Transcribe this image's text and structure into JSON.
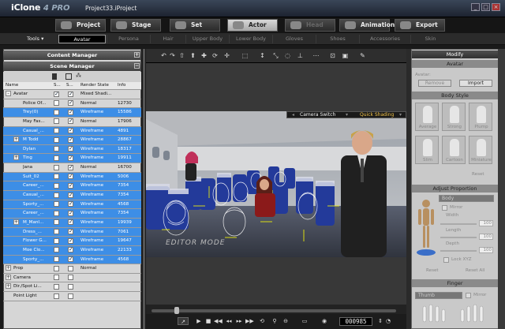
{
  "app": {
    "name": "iClone",
    "version_badge": "4",
    "edition": "PRO",
    "project": "Project33.iProject"
  },
  "window": {
    "minimize": "_",
    "maximize": "□",
    "close": "×"
  },
  "main_tabs": [
    {
      "label": "Project",
      "state": "normal"
    },
    {
      "label": "Stage",
      "state": "normal"
    },
    {
      "label": "Set",
      "state": "normal"
    },
    {
      "label": "Actor",
      "state": "active"
    },
    {
      "label": "Head",
      "state": "disabled"
    },
    {
      "label": "Animation",
      "state": "normal"
    },
    {
      "label": "Export",
      "state": "normal"
    }
  ],
  "tools_label": "Tools ▾",
  "sub_tabs": [
    {
      "label": "Avatar",
      "state": "active"
    },
    {
      "label": "Persona",
      "state": "disabled"
    },
    {
      "label": "Hair",
      "state": "disabled"
    },
    {
      "label": "Upper Body",
      "state": "disabled"
    },
    {
      "label": "Lower Body",
      "state": "disabled"
    },
    {
      "label": "Gloves",
      "state": "disabled"
    },
    {
      "label": "Shoes",
      "state": "disabled"
    },
    {
      "label": "Accessories",
      "state": "disabled"
    },
    {
      "label": "Skin",
      "state": "disabled"
    }
  ],
  "content_manager": {
    "title": "Content Manager"
  },
  "scene_manager": {
    "title": "Scene Manager",
    "columns": {
      "name": "Name",
      "s1": "S...",
      "s2": "S...",
      "render": "Render State",
      "info": "Info"
    },
    "rows": [
      {
        "indent": 0,
        "expander": "-",
        "name": "Avatar",
        "c1": true,
        "c2": true,
        "render": "Mixed Shadi...",
        "info": "",
        "sel": false
      },
      {
        "indent": 1,
        "expander": "",
        "name": "Police Of...",
        "c1": false,
        "c2": true,
        "render": "Normal",
        "info": "12730",
        "sel": false
      },
      {
        "indent": 1,
        "expander": "",
        "name": "Trey(0)",
        "c1": false,
        "c2": true,
        "render": "Wireframe",
        "info": "15586",
        "sel": true
      },
      {
        "indent": 1,
        "expander": "",
        "name": "May Fas...",
        "c1": false,
        "c2": true,
        "render": "Normal",
        "info": "17906",
        "sel": false
      },
      {
        "indent": 1,
        "expander": "",
        "name": "Casual_...",
        "c1": false,
        "c2": true,
        "render": "Wireframe",
        "info": "4891",
        "sel": true
      },
      {
        "indent": 1,
        "expander": "+",
        "name": "M Todd",
        "c1": false,
        "c2": true,
        "render": "Wireframe",
        "info": "28867",
        "sel": true
      },
      {
        "indent": 1,
        "expander": "",
        "name": "Dylan",
        "c1": false,
        "c2": true,
        "render": "Wireframe",
        "info": "18317",
        "sel": true
      },
      {
        "indent": 1,
        "expander": "+",
        "name": "Ting",
        "c1": false,
        "c2": true,
        "render": "Wireframe",
        "info": "19911",
        "sel": true
      },
      {
        "indent": 1,
        "expander": "",
        "name": "Jana",
        "c1": false,
        "c2": true,
        "render": "Normal",
        "info": "16700",
        "sel": false
      },
      {
        "indent": 1,
        "expander": "",
        "name": "Suit_02",
        "c1": false,
        "c2": true,
        "render": "Wireframe",
        "info": "5006",
        "sel": true
      },
      {
        "indent": 1,
        "expander": "",
        "name": "Career_...",
        "c1": false,
        "c2": true,
        "render": "Wireframe",
        "info": "7354",
        "sel": true
      },
      {
        "indent": 1,
        "expander": "",
        "name": "Casual_...",
        "c1": false,
        "c2": true,
        "render": "Wireframe",
        "info": "7354",
        "sel": true
      },
      {
        "indent": 1,
        "expander": "",
        "name": "Sporty_...",
        "c1": false,
        "c2": true,
        "render": "Wireframe",
        "info": "4568",
        "sel": true
      },
      {
        "indent": 1,
        "expander": "",
        "name": "Career_...",
        "c1": false,
        "c2": true,
        "render": "Wireframe",
        "info": "7354",
        "sel": true
      },
      {
        "indent": 1,
        "expander": "+",
        "name": "M_ManI...",
        "c1": false,
        "c2": true,
        "render": "Wireframe",
        "info": "19939",
        "sel": true
      },
      {
        "indent": 1,
        "expander": "",
        "name": "Dress_...",
        "c1": false,
        "c2": true,
        "render": "Wireframe",
        "info": "7061",
        "sel": true
      },
      {
        "indent": 1,
        "expander": "",
        "name": "Flower G...",
        "c1": false,
        "c2": true,
        "render": "Wireframe",
        "info": "19647",
        "sel": true
      },
      {
        "indent": 1,
        "expander": "",
        "name": "Moe Clo...",
        "c1": false,
        "c2": true,
        "render": "Wireframe",
        "info": "22133",
        "sel": true
      },
      {
        "indent": 1,
        "expander": "",
        "name": "Sporty_...",
        "c1": false,
        "c2": true,
        "render": "Wireframe",
        "info": "4568",
        "sel": true
      },
      {
        "indent": 0,
        "expander": "+",
        "name": "Prop",
        "c1": false,
        "c2": false,
        "render": "Normal",
        "info": "",
        "sel": false
      },
      {
        "indent": 0,
        "expander": "+",
        "name": "Camera",
        "c1": false,
        "c2": false,
        "render": "",
        "info": "",
        "sel": false
      },
      {
        "indent": 0,
        "expander": "+",
        "name": "Dir./Spot Li...",
        "c1": false,
        "c2": false,
        "render": "",
        "info": "",
        "sel": false
      },
      {
        "indent": 0,
        "expander": "",
        "name": "Point Light",
        "c1": false,
        "c2": false,
        "render": "",
        "info": "",
        "sel": false
      }
    ]
  },
  "viewport": {
    "camera_switch": "Camera Switch",
    "shading": "Quick Shading",
    "mode": "EDITOR MODE",
    "frame": "000985"
  },
  "modify": {
    "title": "Modify",
    "section": "Avatar",
    "avatar_label": "Avatar:",
    "remove": "Remove",
    "import": "Import",
    "body_style": {
      "title": "Body Style",
      "slots": [
        "Average",
        "Strong",
        "Plump",
        "Slim",
        "Cartoon",
        "Miniature"
      ],
      "reset": "Reset"
    },
    "adjust_proportion": {
      "title": "Adjust Proportion",
      "target": "Body",
      "mirror": "Mirror",
      "width": "Width",
      "length": "Length",
      "depth": "Depth",
      "value": "100",
      "lock": "Lock XYZ",
      "reset": "Reset",
      "reset_all": "Reset All"
    },
    "finger": {
      "title": "Finger",
      "target": "Thumb",
      "mirror": "Mirror"
    }
  }
}
